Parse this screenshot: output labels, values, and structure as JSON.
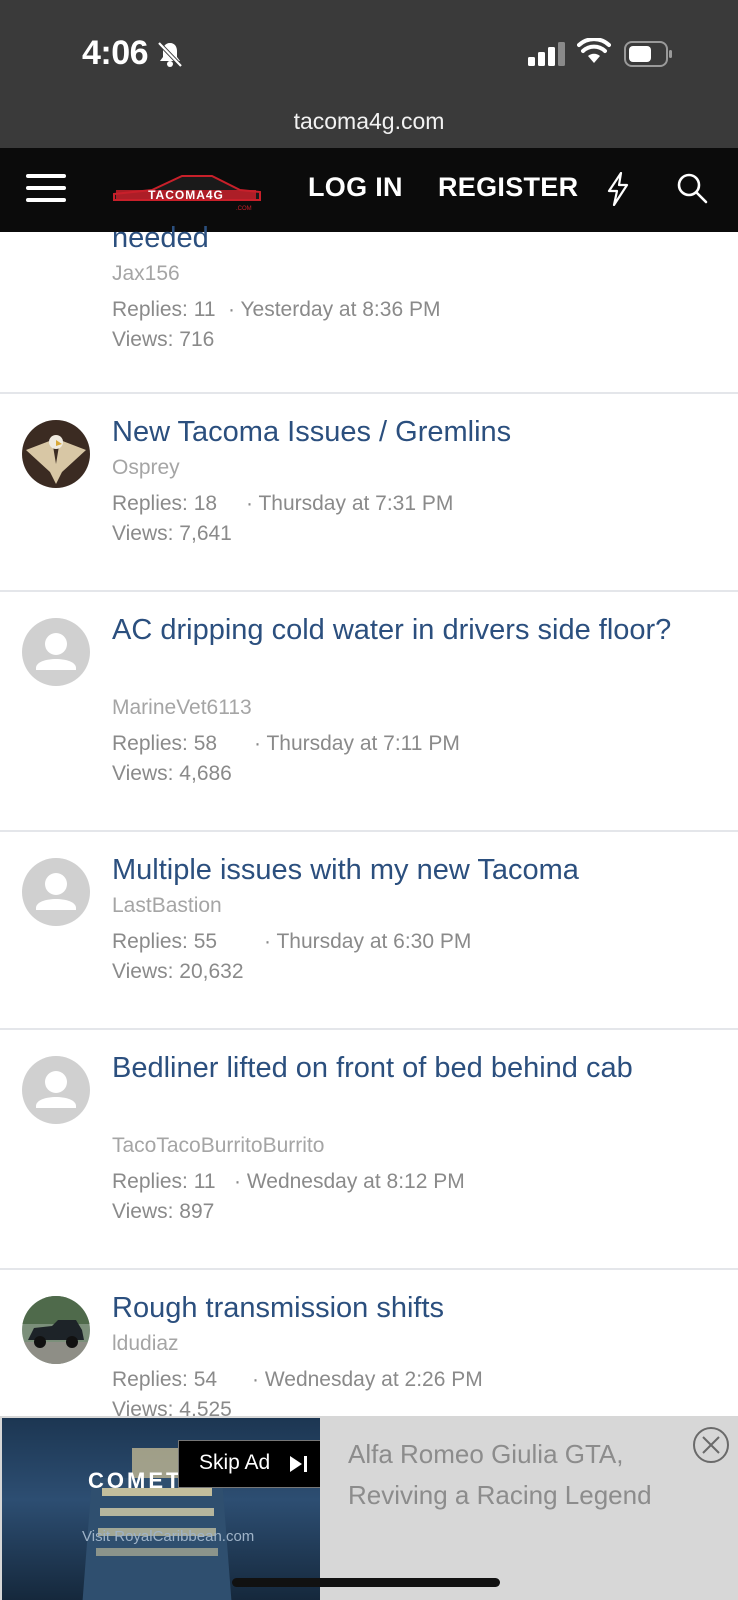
{
  "status_bar": {
    "time": "4:06",
    "url": "tacoma4g.com"
  },
  "navbar": {
    "logo_text": "TACOMA4G",
    "login_label": "LOG IN",
    "register_label": "REGISTER"
  },
  "threads": [
    {
      "title": "needed",
      "author": "Jax156",
      "replies": "Replies: 11",
      "date": "· Yesterday at 8:36 PM",
      "views": "Views: 716",
      "avatar": "none"
    },
    {
      "title": "New Tacoma Issues / Gremlins",
      "author": "Osprey",
      "replies": "Replies: 18",
      "date": "· Thursday at 7:31 PM",
      "views": "Views: 7,641",
      "avatar": "eagle-photo"
    },
    {
      "title": "AC dripping cold water in drivers side floor?",
      "author": "MarineVet6113",
      "replies": "Replies: 58",
      "date": "· Thursday at 7:11 PM",
      "views": "Views: 4,686",
      "avatar": "default-user-icon"
    },
    {
      "title": "Multiple issues with my new Tacoma",
      "author": "LastBastion",
      "replies": "Replies: 55",
      "date": "· Thursday at 6:30 PM",
      "views": "Views: 20,632",
      "avatar": "default-user-icon"
    },
    {
      "title": "Bedliner lifted on front of bed behind cab",
      "author": "TacoTacoBurritoBurrito",
      "replies": "Replies: 11",
      "date": "· Wednesday at 8:12 PM",
      "views": "Views: 897",
      "avatar": "default-user-icon"
    },
    {
      "title": "Rough transmission shifts",
      "author": "ldudiaz",
      "replies": "Replies: 54",
      "date": "· Wednesday at 2:26 PM",
      "views": "Views: 4,525",
      "avatar": "truck-photo"
    }
  ],
  "ad": {
    "brand": "COMET",
    "visit_text": "Visit RoyalCaribbean.com",
    "skip_label": "Skip Ad",
    "headline": "Alfa Romeo Giulia GTA, Reviving a Racing Legend"
  },
  "colors": {
    "link": "#2b4f7e",
    "navbar": "#0b0b0b",
    "status_bar": "#3a3a3a"
  }
}
